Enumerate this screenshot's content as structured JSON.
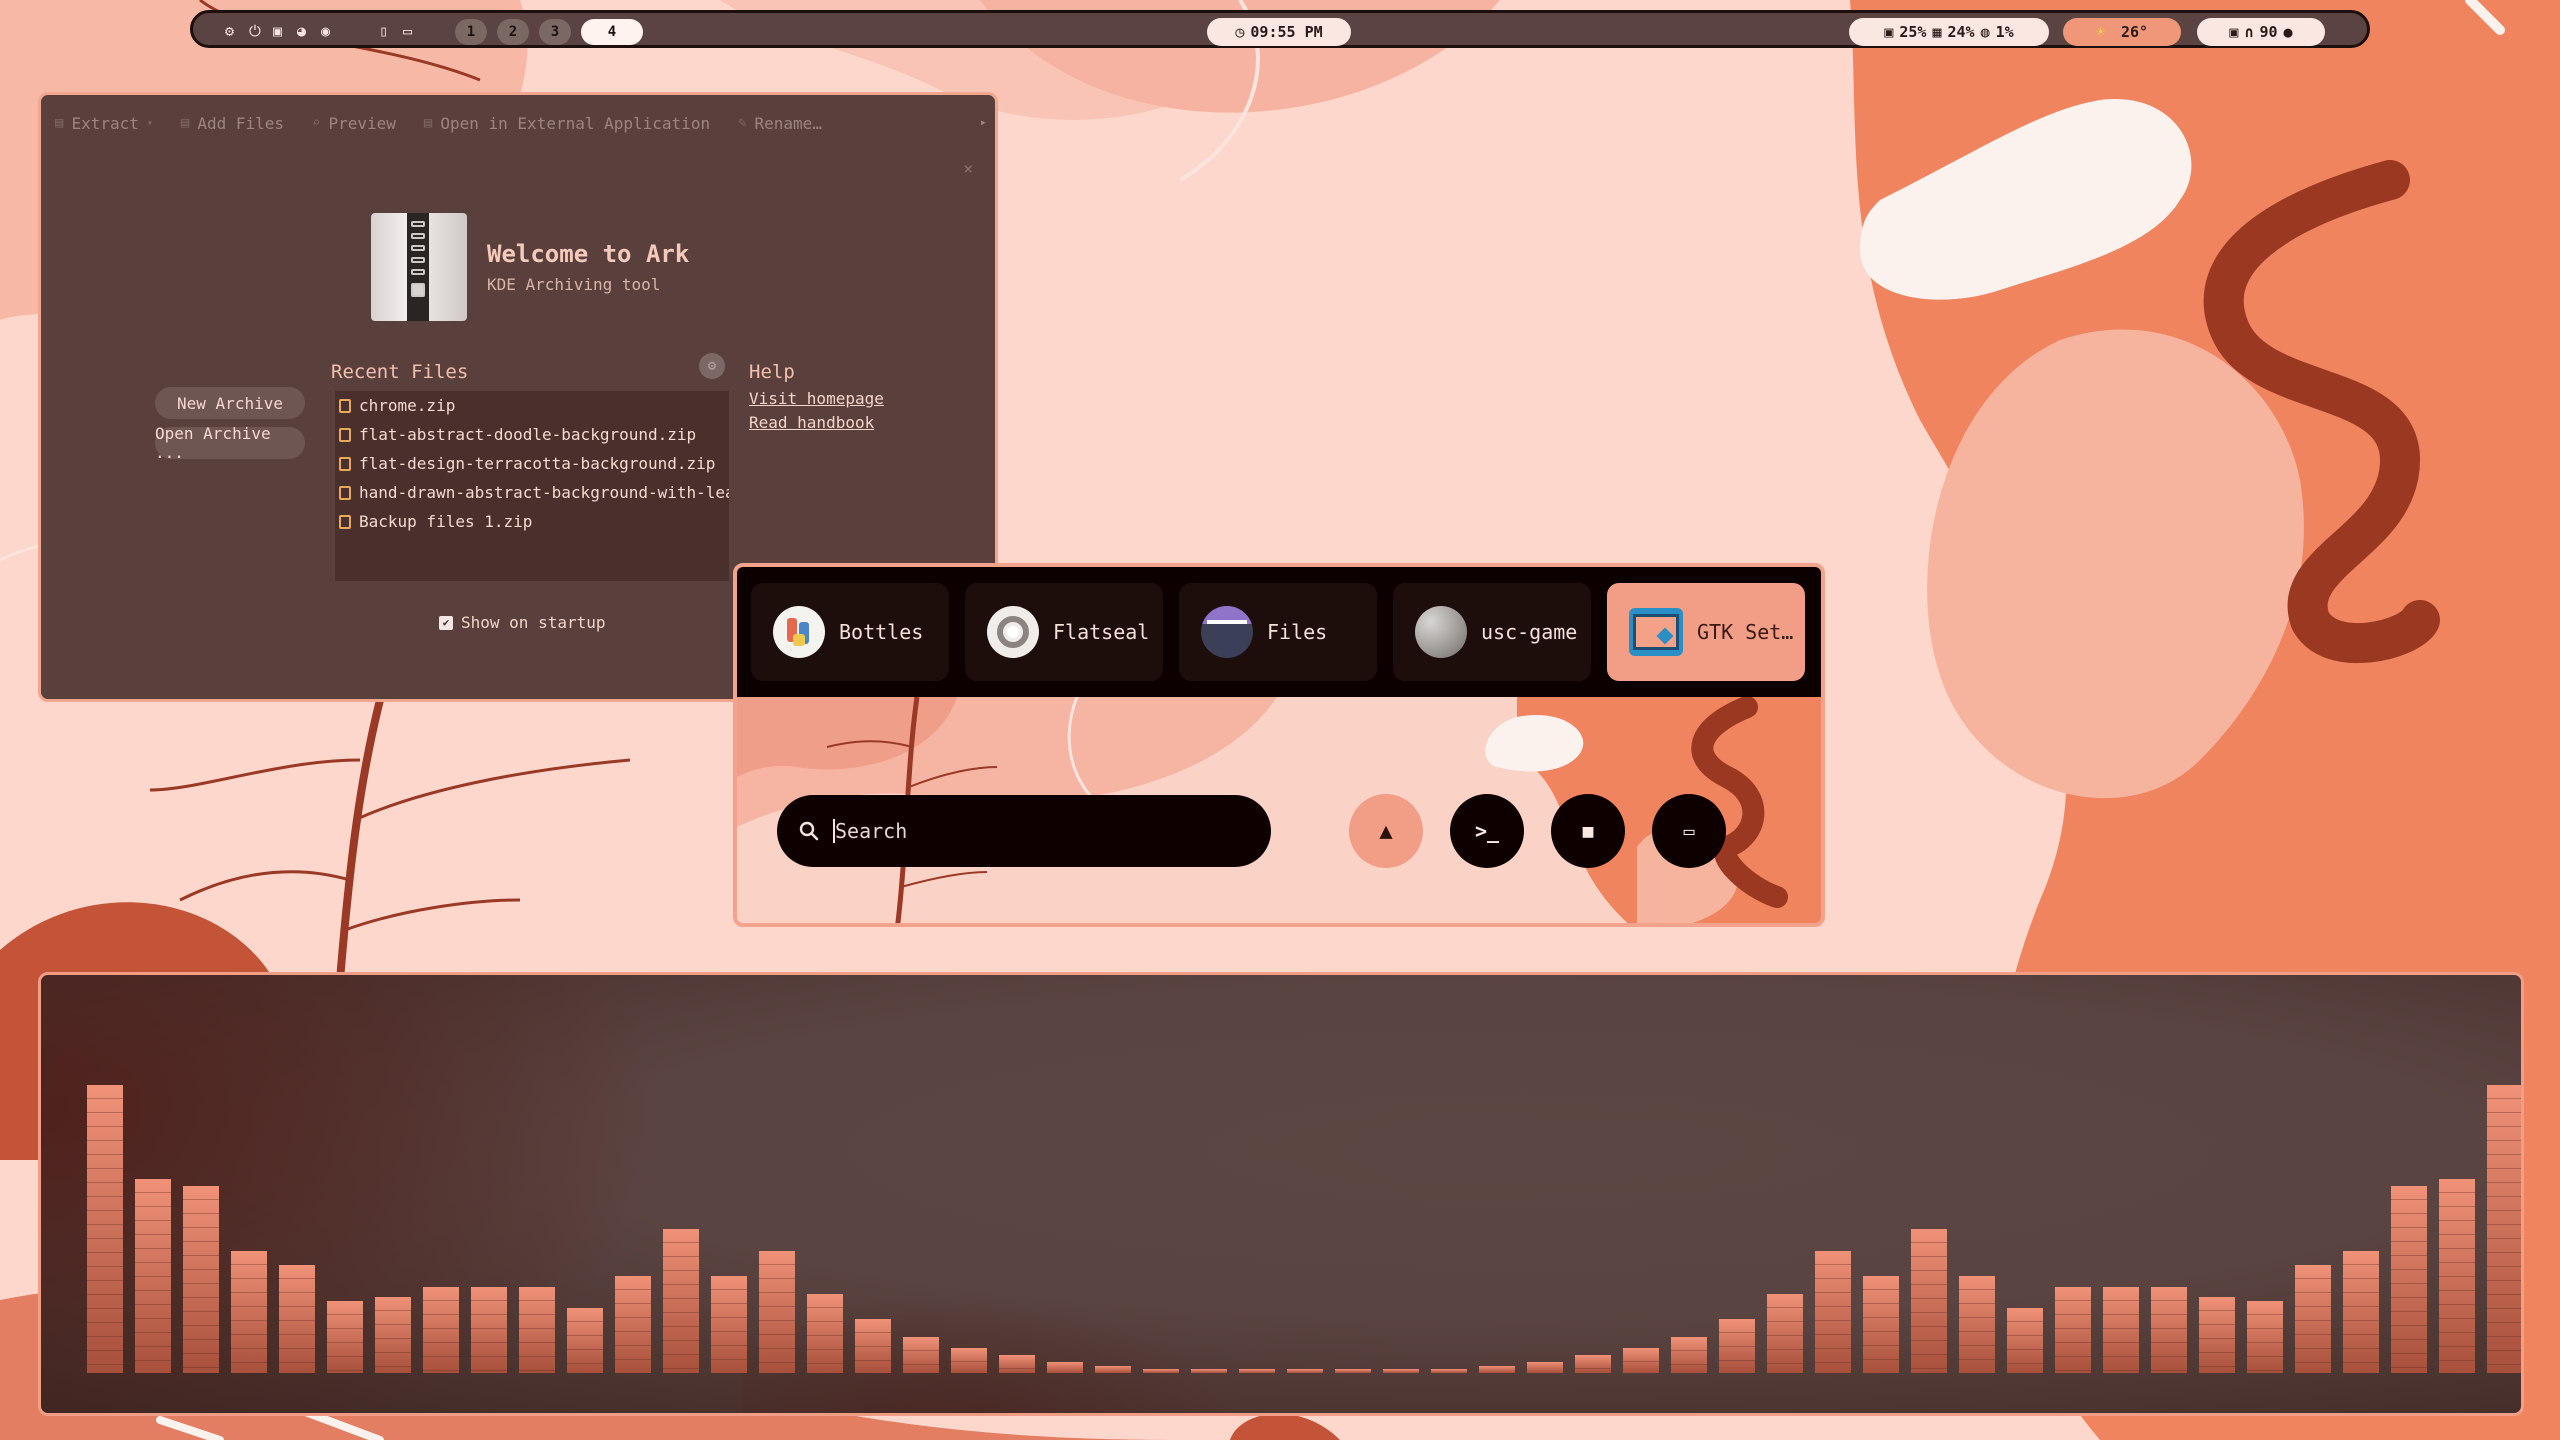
{
  "topbar": {
    "left_icons": [
      "gear-icon",
      "power-icon",
      "picture-icon",
      "palette-icon",
      "screenshot-icon",
      "phone-icon",
      "tablet-icon"
    ],
    "workspaces": [
      "1",
      "2",
      "3",
      "4"
    ],
    "active_workspace": "4",
    "clock": "09:55 PM",
    "system": {
      "cpu": "25%",
      "memory": "24%",
      "disk": "1%"
    },
    "weather": "26°",
    "audio": {
      "volume": "90"
    }
  },
  "ark": {
    "toolbar": {
      "extract": "Extract",
      "add_files": "Add Files",
      "preview": "Preview",
      "open_external": "Open in External Application",
      "rename": "Rename…"
    },
    "title": "Welcome to Ark",
    "subtitle": "KDE Archiving tool",
    "new_archive": "New Archive",
    "open_archive": "Open Archive ...",
    "recent_heading": "Recent Files",
    "recent_files": [
      "chrome.zip",
      "flat-abstract-doodle-background.zip",
      "flat-design-terracotta-background.zip",
      "hand-drawn-abstract-background-with-lea",
      "Backup files 1.zip"
    ],
    "help_heading": "Help",
    "visit_homepage": "Visit homepage",
    "read_handbook": "Read handbook",
    "show_on_startup": "Show on startup"
  },
  "launcher": {
    "apps": [
      "Bottles",
      "Flatseal",
      "Files",
      "usc-game",
      "GTK Set…"
    ],
    "selected_app": "GTK Set…",
    "search_placeholder": "Search"
  },
  "visualizer": {
    "levels": [
      0.8,
      0.54,
      0.52,
      0.34,
      0.3,
      0.2,
      0.21,
      0.24,
      0.24,
      0.24,
      0.18,
      0.27,
      0.4,
      0.27,
      0.34,
      0.22,
      0.15,
      0.1,
      0.07,
      0.05,
      0.03,
      0.02,
      0.01,
      0.01,
      0.01,
      0.01,
      0.01,
      0.01,
      0.01,
      0.02,
      0.03,
      0.05,
      0.07,
      0.1,
      0.15,
      0.22,
      0.34,
      0.27,
      0.4,
      0.27,
      0.18,
      0.24,
      0.24,
      0.24,
      0.21,
      0.2,
      0.3,
      0.34,
      0.52,
      0.54,
      0.8
    ]
  },
  "colors": {
    "accent": "#f29e86",
    "bar_top": "#ef9278",
    "bar_bottom": "#a7503c",
    "window_bg": "#5a403c"
  }
}
